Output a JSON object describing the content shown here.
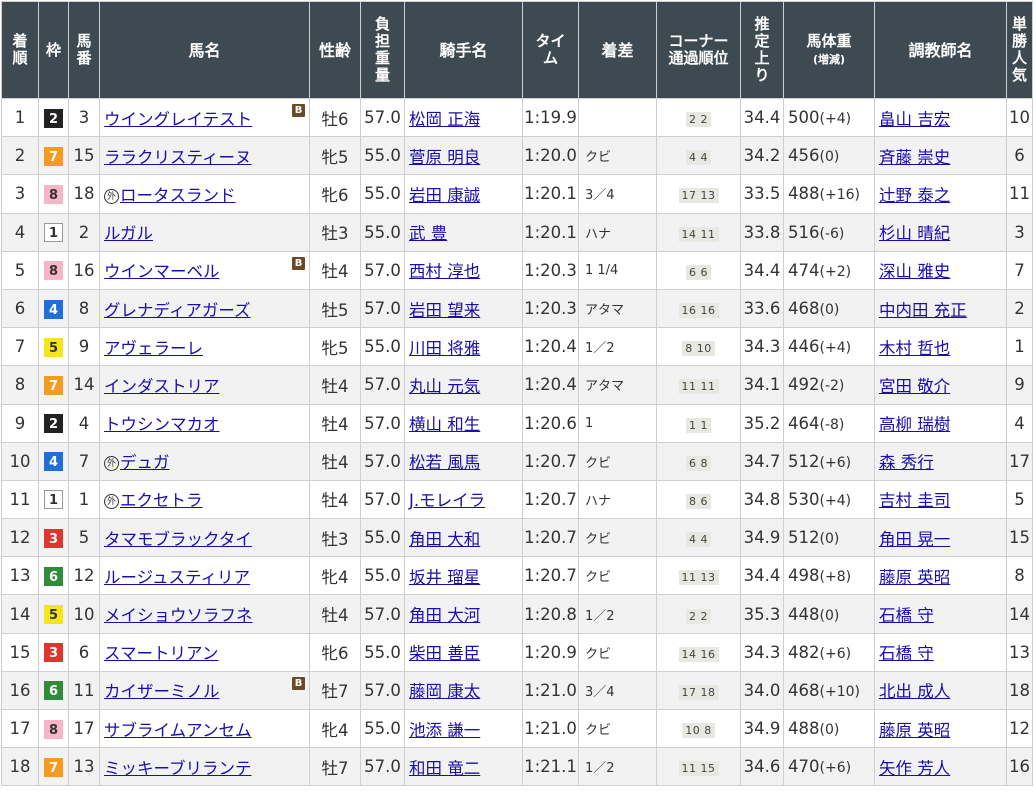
{
  "headers": {
    "rank": "着\n順",
    "frame": "枠",
    "num": "馬\n番",
    "name": "馬名",
    "sexage": "性齢",
    "weight": "負\n担\n重\n量",
    "jockey": "騎手名",
    "time": "タイ\nム",
    "diff": "着差",
    "corner": "コーナー\n通過順位",
    "last3f": "推\n定\n上\nり",
    "bodyweight": "馬体重",
    "bodyweight_sub": "(増減)",
    "trainer": "調教師名",
    "pop": "単\n勝\n人\n気"
  },
  "frame_colors": {
    "1": {
      "bg": "#ffffff",
      "fg": "#333333",
      "border": "#999999"
    },
    "2": {
      "bg": "#222222",
      "fg": "#ffffff",
      "border": "#222222"
    },
    "3": {
      "bg": "#e0342f",
      "fg": "#ffffff",
      "border": "#e0342f"
    },
    "4": {
      "bg": "#1f6fd6",
      "fg": "#ffffff",
      "border": "#1f6fd6"
    },
    "5": {
      "bg": "#f5e51c",
      "fg": "#333333",
      "border": "#f5e51c"
    },
    "6": {
      "bg": "#2f8c3a",
      "fg": "#ffffff",
      "border": "#2f8c3a"
    },
    "7": {
      "bg": "#f59a22",
      "fg": "#ffffff",
      "border": "#f59a22"
    },
    "8": {
      "bg": "#f6b6c8",
      "fg": "#333333",
      "border": "#f6b6c8"
    }
  },
  "icons": {
    "blinker": "B",
    "foreign": "外"
  },
  "rows": [
    {
      "rank": "1",
      "frame": "2",
      "num": "3",
      "name": "ウイングレイテスト",
      "blinker": true,
      "foreign": false,
      "sexage": "牡6",
      "weight": "57.0",
      "jockey": "松岡 正海",
      "time": "1:19.9",
      "diff": "",
      "corner": "2 2",
      "last3f": "34.4",
      "bw": "500",
      "bwc": "(+4)",
      "trainer": "畠山 吉宏",
      "pop": "10"
    },
    {
      "rank": "2",
      "frame": "7",
      "num": "15",
      "name": "ララクリスティーヌ",
      "blinker": false,
      "foreign": false,
      "sexage": "牝5",
      "weight": "55.0",
      "jockey": "菅原 明良",
      "time": "1:20.0",
      "diff": "クビ",
      "corner": "4 4",
      "last3f": "34.2",
      "bw": "456",
      "bwc": "(0)",
      "trainer": "斉藤 崇史",
      "pop": "6"
    },
    {
      "rank": "3",
      "frame": "8",
      "num": "18",
      "name": "ロータスランド",
      "blinker": false,
      "foreign": true,
      "sexage": "牝6",
      "weight": "55.0",
      "jockey": "岩田 康誠",
      "time": "1:20.1",
      "diff": "3／4",
      "corner": "17 13",
      "last3f": "33.5",
      "bw": "488",
      "bwc": "(+16)",
      "trainer": "辻野 泰之",
      "pop": "11"
    },
    {
      "rank": "4",
      "frame": "1",
      "num": "2",
      "name": "ルガル",
      "blinker": false,
      "foreign": false,
      "sexage": "牡3",
      "weight": "55.0",
      "jockey": "武 豊",
      "time": "1:20.1",
      "diff": "ハナ",
      "corner": "14 11",
      "last3f": "33.8",
      "bw": "516",
      "bwc": "(-6)",
      "trainer": "杉山 晴紀",
      "pop": "3"
    },
    {
      "rank": "5",
      "frame": "8",
      "num": "16",
      "name": "ウインマーベル",
      "blinker": true,
      "foreign": false,
      "sexage": "牡4",
      "weight": "57.0",
      "jockey": "西村 淳也",
      "time": "1:20.3",
      "diff": "1 1/4",
      "corner": "6 6",
      "last3f": "34.4",
      "bw": "474",
      "bwc": "(+2)",
      "trainer": "深山 雅史",
      "pop": "7"
    },
    {
      "rank": "6",
      "frame": "4",
      "num": "8",
      "name": "グレナディアガーズ",
      "blinker": false,
      "foreign": false,
      "sexage": "牡5",
      "weight": "57.0",
      "jockey": "岩田 望来",
      "time": "1:20.3",
      "diff": "アタマ",
      "corner": "16 16",
      "last3f": "33.6",
      "bw": "468",
      "bwc": "(0)",
      "trainer": "中内田 充正",
      "pop": "2"
    },
    {
      "rank": "7",
      "frame": "5",
      "num": "9",
      "name": "アヴェラーレ",
      "blinker": false,
      "foreign": false,
      "sexage": "牝5",
      "weight": "55.0",
      "jockey": "川田 将雅",
      "time": "1:20.4",
      "diff": "1／2",
      "corner": "8 10",
      "last3f": "34.3",
      "bw": "446",
      "bwc": "(+4)",
      "trainer": "木村 哲也",
      "pop": "1"
    },
    {
      "rank": "8",
      "frame": "7",
      "num": "14",
      "name": "インダストリア",
      "blinker": false,
      "foreign": false,
      "sexage": "牡4",
      "weight": "57.0",
      "jockey": "丸山 元気",
      "time": "1:20.4",
      "diff": "アタマ",
      "corner": "11 11",
      "last3f": "34.1",
      "bw": "492",
      "bwc": "(-2)",
      "trainer": "宮田 敬介",
      "pop": "9"
    },
    {
      "rank": "9",
      "frame": "2",
      "num": "4",
      "name": "トウシンマカオ",
      "blinker": false,
      "foreign": false,
      "sexage": "牡4",
      "weight": "57.0",
      "jockey": "横山 和生",
      "time": "1:20.6",
      "diff": "1",
      "corner": "1 1",
      "last3f": "35.2",
      "bw": "464",
      "bwc": "(-8)",
      "trainer": "高柳 瑞樹",
      "pop": "4"
    },
    {
      "rank": "10",
      "frame": "4",
      "num": "7",
      "name": "デュガ",
      "blinker": false,
      "foreign": true,
      "sexage": "牡4",
      "weight": "57.0",
      "jockey": "松若 風馬",
      "time": "1:20.7",
      "diff": "クビ",
      "corner": "6 8",
      "last3f": "34.7",
      "bw": "512",
      "bwc": "(+6)",
      "trainer": "森 秀行",
      "pop": "17"
    },
    {
      "rank": "11",
      "frame": "1",
      "num": "1",
      "name": "エクセトラ",
      "blinker": false,
      "foreign": true,
      "sexage": "牡4",
      "weight": "57.0",
      "jockey": "J.モレイラ",
      "time": "1:20.7",
      "diff": "ハナ",
      "corner": "8 6",
      "last3f": "34.8",
      "bw": "530",
      "bwc": "(+4)",
      "trainer": "吉村 圭司",
      "pop": "5"
    },
    {
      "rank": "12",
      "frame": "3",
      "num": "5",
      "name": "タマモブラックタイ",
      "blinker": false,
      "foreign": false,
      "sexage": "牡3",
      "weight": "55.0",
      "jockey": "角田 大和",
      "time": "1:20.7",
      "diff": "クビ",
      "corner": "4 4",
      "last3f": "34.9",
      "bw": "512",
      "bwc": "(0)",
      "trainer": "角田 晃一",
      "pop": "15"
    },
    {
      "rank": "13",
      "frame": "6",
      "num": "12",
      "name": "ルージュスティリア",
      "blinker": false,
      "foreign": false,
      "sexage": "牝4",
      "weight": "55.0",
      "jockey": "坂井 瑠星",
      "time": "1:20.7",
      "diff": "クビ",
      "corner": "11 13",
      "last3f": "34.4",
      "bw": "498",
      "bwc": "(+8)",
      "trainer": "藤原 英昭",
      "pop": "8"
    },
    {
      "rank": "14",
      "frame": "5",
      "num": "10",
      "name": "メイショウソラフネ",
      "blinker": false,
      "foreign": false,
      "sexage": "牡4",
      "weight": "57.0",
      "jockey": "角田 大河",
      "time": "1:20.8",
      "diff": "1／2",
      "corner": "2 2",
      "last3f": "35.3",
      "bw": "448",
      "bwc": "(0)",
      "trainer": "石橋 守",
      "pop": "14"
    },
    {
      "rank": "15",
      "frame": "3",
      "num": "6",
      "name": "スマートリアン",
      "blinker": false,
      "foreign": false,
      "sexage": "牝6",
      "weight": "55.0",
      "jockey": "柴田 善臣",
      "time": "1:20.9",
      "diff": "クビ",
      "corner": "14 16",
      "last3f": "34.3",
      "bw": "482",
      "bwc": "(+6)",
      "trainer": "石橋 守",
      "pop": "13"
    },
    {
      "rank": "16",
      "frame": "6",
      "num": "11",
      "name": "カイザーミノル",
      "blinker": true,
      "foreign": false,
      "sexage": "牡7",
      "weight": "57.0",
      "jockey": "藤岡 康太",
      "time": "1:21.0",
      "diff": "3／4",
      "corner": "17 18",
      "last3f": "34.0",
      "bw": "468",
      "bwc": "(+10)",
      "trainer": "北出 成人",
      "pop": "18"
    },
    {
      "rank": "17",
      "frame": "8",
      "num": "17",
      "name": "サブライムアンセム",
      "blinker": false,
      "foreign": false,
      "sexage": "牝4",
      "weight": "55.0",
      "jockey": "池添 謙一",
      "time": "1:21.0",
      "diff": "クビ",
      "corner": "10 8",
      "last3f": "34.9",
      "bw": "488",
      "bwc": "(0)",
      "trainer": "藤原 英昭",
      "pop": "12"
    },
    {
      "rank": "18",
      "frame": "7",
      "num": "13",
      "name": "ミッキーブリランテ",
      "blinker": false,
      "foreign": false,
      "sexage": "牡7",
      "weight": "57.0",
      "jockey": "和田 竜二",
      "time": "1:21.1",
      "diff": "1／2",
      "corner": "11 15",
      "last3f": "34.6",
      "bw": "470",
      "bwc": "(+6)",
      "trainer": "矢作 芳人",
      "pop": "16"
    }
  ]
}
